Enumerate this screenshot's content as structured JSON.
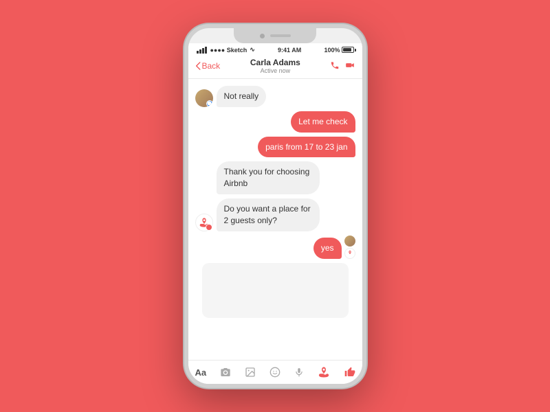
{
  "background_color": "#F05A5B",
  "phone": {
    "status_bar": {
      "left": "●●●● Sketch",
      "wifi": "WiFi",
      "time": "9:41 AM",
      "battery": "100%"
    },
    "nav": {
      "back_label": "Back",
      "contact_name": "Carla Adams",
      "contact_status": "Active now"
    },
    "messages": [
      {
        "id": 1,
        "type": "incoming",
        "avatar": "person",
        "text": "Not really"
      },
      {
        "id": 2,
        "type": "outgoing",
        "text": "Let me check"
      },
      {
        "id": 3,
        "type": "outgoing",
        "text": "paris from 17 to 23 jan"
      },
      {
        "id": 4,
        "type": "incoming-noavatar",
        "text": "Thank you for choosing Airbnb"
      },
      {
        "id": 5,
        "type": "incoming",
        "avatar": "airbnb",
        "text": "Do you want a place for 2 guests only?"
      },
      {
        "id": 6,
        "type": "outgoing-yes",
        "text": "yes"
      }
    ],
    "toolbar": {
      "text_btn": "Aa",
      "camera_btn": "📷",
      "gallery_btn": "🖼",
      "emoji_btn": "😊",
      "mic_btn": "🎤",
      "airbnb_btn": "airbnb",
      "like_btn": "👍"
    }
  }
}
